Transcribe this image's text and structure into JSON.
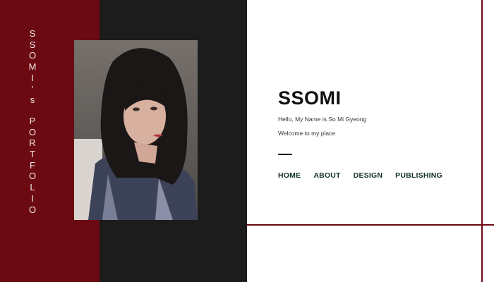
{
  "sidebar": {
    "letters_line1": [
      "S",
      "S",
      "O",
      "M",
      "I",
      "'",
      "s"
    ],
    "letters_line2": [
      "P",
      "O",
      "R",
      "T",
      "F",
      "O",
      "L",
      "I",
      "O"
    ]
  },
  "hero": {
    "photo_alt": "portrait"
  },
  "brand": {
    "title": "SSOMI",
    "tagline": "Hello, My Name is So Mi Gyeong",
    "welcome": "Welcome to my place"
  },
  "nav": {
    "items": [
      "HOME",
      "ABOUT",
      "DESIGN",
      "PUBLISHING"
    ]
  },
  "colors": {
    "accent": "#6b0a12",
    "dark": "#1c1c1c",
    "nav_text": "#123128"
  }
}
